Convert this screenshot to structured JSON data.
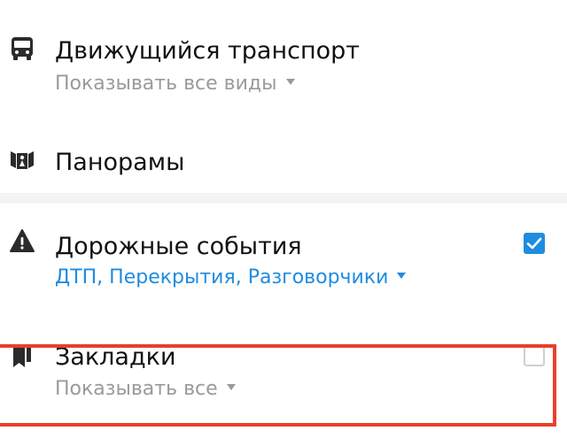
{
  "layers": [
    {
      "icon": "bus-icon",
      "title": "Движущийся транспорт",
      "subtitle": "Показывать все виды",
      "subtitle_style": "gray",
      "has_dropdown": true,
      "checkbox": null
    },
    {
      "icon": "panorama-icon",
      "title": "Панорамы",
      "subtitle": "",
      "has_dropdown": false,
      "checkbox": null
    },
    {
      "icon": "warning-triangle-icon",
      "title": "Дорожные события",
      "subtitle": "ДТП, Перекрытия, Разговорчики",
      "subtitle_style": "blue",
      "has_dropdown": true,
      "checkbox": "checked"
    },
    {
      "icon": "bookmark-icon",
      "title": "Закладки",
      "subtitle": "Показывать все",
      "subtitle_style": "gray",
      "has_dropdown": true,
      "checkbox": "unchecked",
      "highlighted": true
    }
  ],
  "colors": {
    "accent": "#1f8ce0",
    "text": "#111111",
    "muted": "#9a9a9a",
    "highlight": "#e8402a",
    "divider": "#f3f3f3"
  }
}
